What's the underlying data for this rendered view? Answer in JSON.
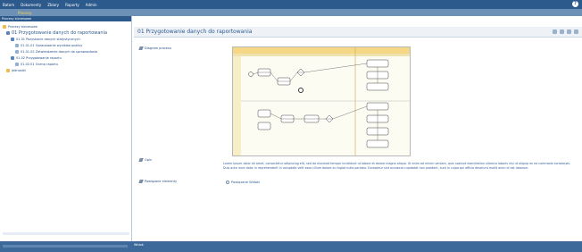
{
  "topbar": {
    "menu": [
      "Batom",
      "Dokumenty",
      "Zbiory",
      "Raporty",
      "Admin"
    ],
    "help_label": "?"
  },
  "subbar": {
    "items": [
      "",
      "",
      "Procesy",
      ""
    ]
  },
  "left_panel": {
    "header": "Procesy biznesowe",
    "tree": [
      {
        "label": "Procesy biznesowe",
        "kind": "folder",
        "level": 0
      },
      {
        "label": "01 Przygotowanie danych do raportowania",
        "kind": "proc",
        "level": 1,
        "big": true
      },
      {
        "label": "01.01 Pozyskanie danych statystycznych",
        "kind": "proc",
        "level": 2
      },
      {
        "label": "01.01.01 Opracowanie wyników analizy",
        "kind": "doc",
        "level": 3
      },
      {
        "label": "01.01.02 Zatwierdzenie danych do sprawozdania",
        "kind": "doc",
        "level": 3
      },
      {
        "label": "01.02 Przygotowanie raportu",
        "kind": "proc",
        "level": 2
      },
      {
        "label": "01.02.01 Ocena raportu",
        "kind": "doc",
        "level": 3
      },
      {
        "label": "Jednostki",
        "kind": "folder",
        "level": 1
      }
    ],
    "footer_button": "Filtr"
  },
  "main": {
    "title": "01 Przygotowanie danych do raportowania",
    "labels": {
      "diagram": "Diagram procesu",
      "description": "Opis",
      "relations": "Powiązane elementy"
    },
    "description_text": "Lorem ipsum dolor sit amet, consectetur adipiscing elit, sed do eiusmod tempor incididunt ut labore et dolore magna aliqua. Ut enim ad minim veniam, quis nostrud exercitation ullamco laboris nisi ut aliquip ex ea commodo consequat. Duis aute irure dolor in reprehenderit in voluptate velit esse cillum dolore eu fugiat nulla pariatur. Excepteur sint occaecat cupidatat non proident, sunt in culpa qui officia deserunt mollit anim id est laborum.",
    "relations_value": "Powiązane Widoki"
  },
  "statusbar": {
    "items": [
      "Widok",
      "",
      "",
      ""
    ]
  },
  "colors": {
    "header_blue": "#2d5a8c",
    "subbar_blue": "#6d90b6",
    "status_blue": "#3c6999",
    "lane_yellow": "#f6d785"
  }
}
